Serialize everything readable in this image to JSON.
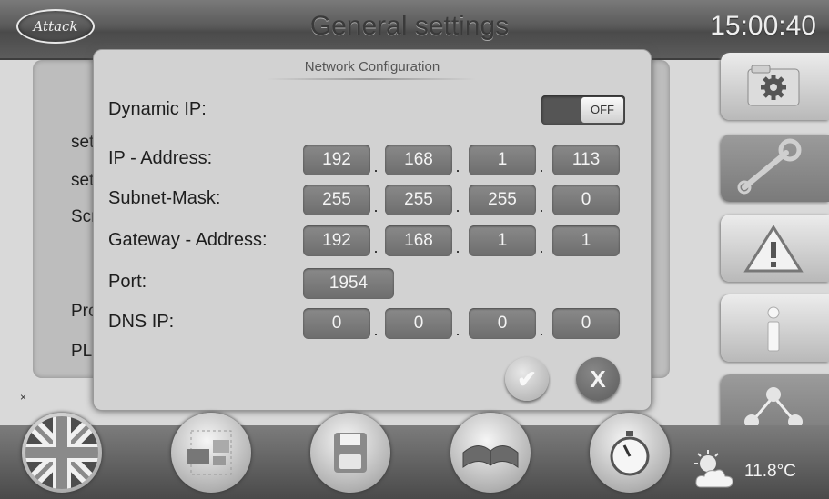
{
  "header": {
    "logo_text": "Attack",
    "title": "General settings",
    "clock": "15:00:40"
  },
  "background_panel": {
    "rows": [
      "set",
      "set",
      "Scr",
      "Pro",
      "PL"
    ],
    "corner_mark": "×"
  },
  "dialog": {
    "title": "Network Configuration",
    "dynamic_ip": {
      "label": "Dynamic IP:",
      "toggle_text": "OFF",
      "state": "off"
    },
    "ip_address": {
      "label": "IP - Address:",
      "octets": [
        "192",
        "168",
        "1",
        "113"
      ]
    },
    "subnet_mask": {
      "label": "Subnet-Mask:",
      "octets": [
        "255",
        "255",
        "255",
        "0"
      ]
    },
    "gateway": {
      "label": "Gateway - Address:",
      "octets": [
        "192",
        "168",
        "1",
        "1"
      ]
    },
    "port": {
      "label": "Port:",
      "value": "1954"
    },
    "dns_ip": {
      "label": "DNS IP:",
      "octets": [
        "0",
        "0",
        "0",
        "0"
      ]
    },
    "dot": ".",
    "ok_glyph": "✔",
    "cancel_glyph": "X"
  },
  "side_menu": [
    {
      "icon": "settings-folder-icon",
      "active": false
    },
    {
      "icon": "wrench-icon",
      "active": true
    },
    {
      "icon": "warning-icon",
      "active": false
    },
    {
      "icon": "info-icon",
      "active": false
    },
    {
      "icon": "network-icon",
      "active": true
    }
  ],
  "bottom_bar": {
    "buttons": [
      "uk-flag-icon",
      "screen-layout-icon",
      "save-icon",
      "manual-book-icon",
      "stopwatch-icon"
    ],
    "weather_icon": "partly-cloudy-icon",
    "temperature": "11.8°C"
  }
}
